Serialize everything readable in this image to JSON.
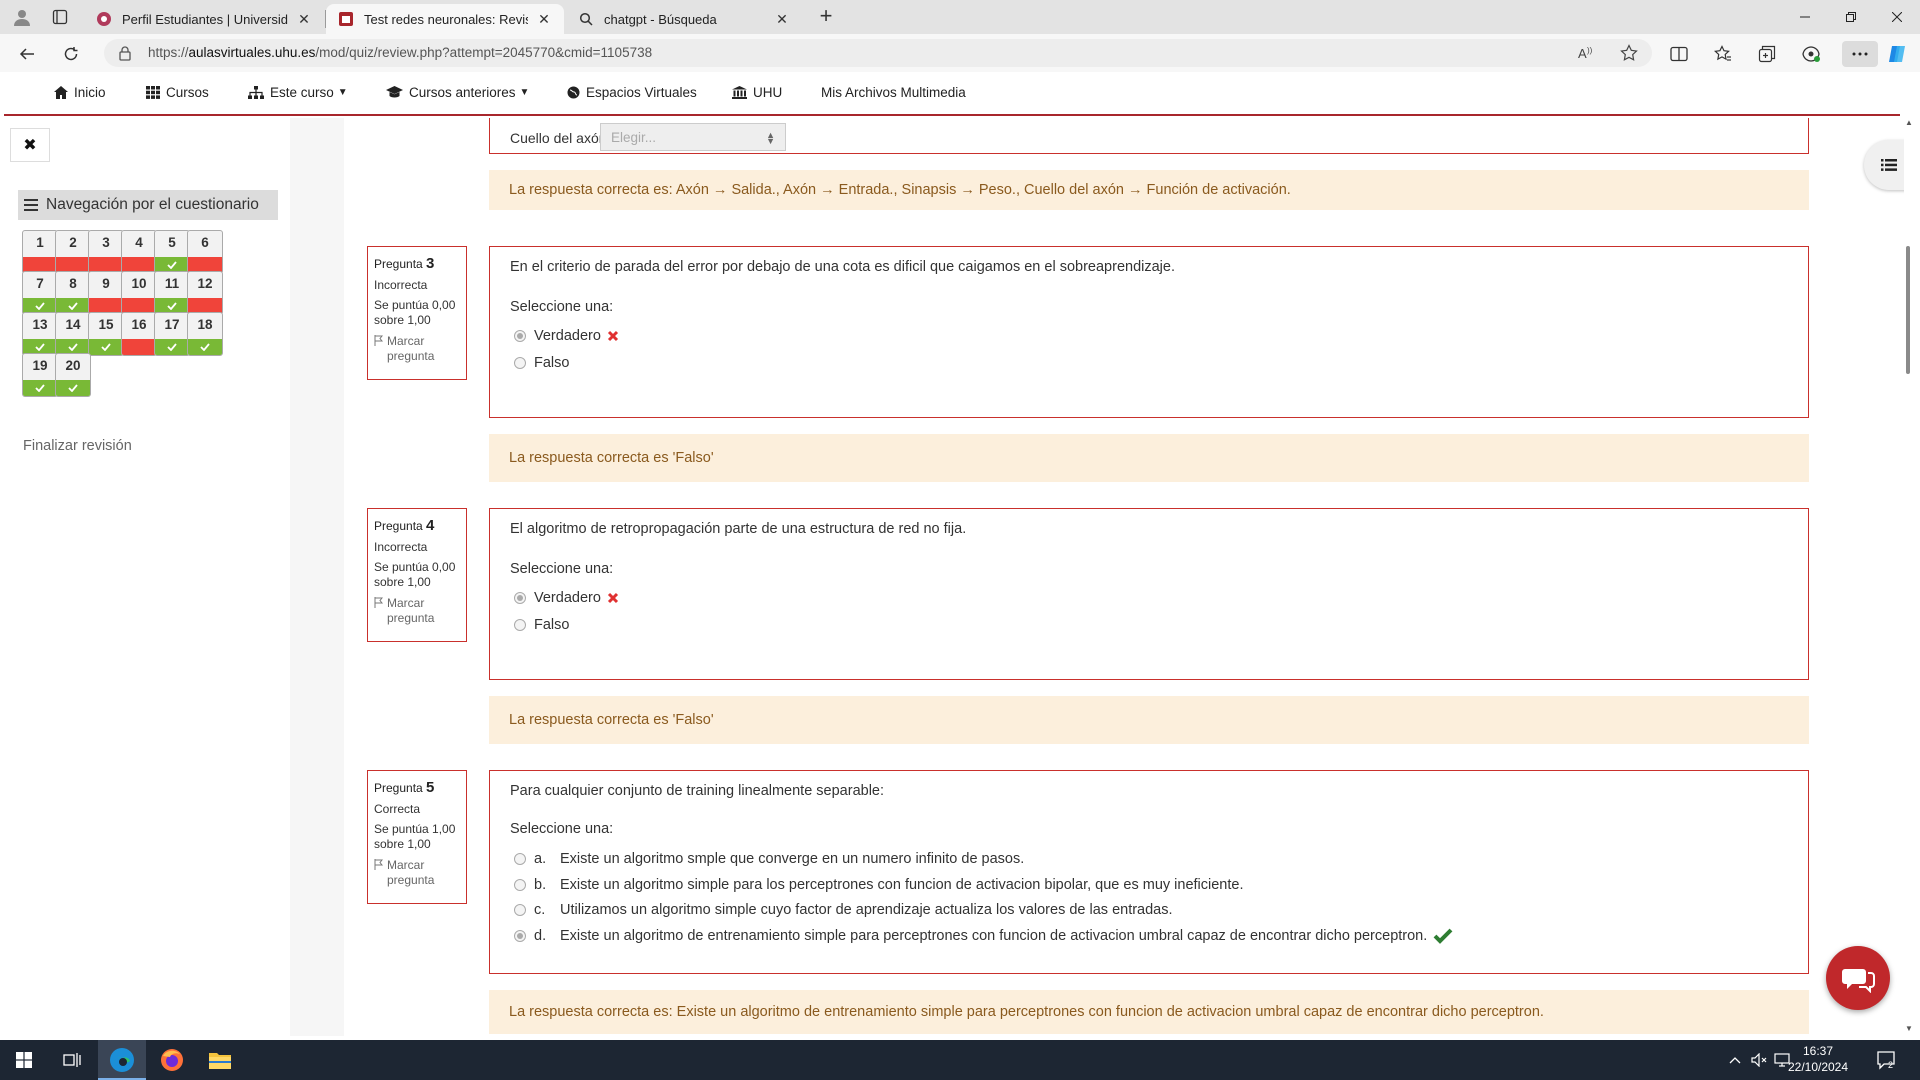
{
  "browser": {
    "tabs": [
      {
        "title": "Perfil Estudiantes | Universidad de",
        "active": false
      },
      {
        "title": "Test redes neuronales: Revisión de",
        "active": true
      },
      {
        "title": "chatgpt - Búsqueda",
        "active": false
      }
    ],
    "url_prefix": "https://",
    "url_host": "aulasvirtuales.uhu.es",
    "url_path": "/mod/quiz/review.php?attempt=2045770&cmid=1105738"
  },
  "site_nav": {
    "items": [
      {
        "label": "Inicio",
        "icon": "home-icon",
        "dropdown": false
      },
      {
        "label": "Cursos",
        "icon": "grid-icon",
        "dropdown": false
      },
      {
        "label": "Este curso",
        "icon": "sitemap-icon",
        "dropdown": true
      },
      {
        "label": "Cursos anteriores",
        "icon": "graduation-cap-icon",
        "dropdown": true
      },
      {
        "label": "Espacios Virtuales",
        "icon": "globe-icon",
        "dropdown": false
      },
      {
        "label": "UHU",
        "icon": "university-icon",
        "dropdown": false
      },
      {
        "label": "Mis Archivos Multimedia",
        "icon": "",
        "dropdown": false
      }
    ]
  },
  "quiz_nav": {
    "heading": "Navegación por el cuestionario",
    "questions": [
      {
        "n": "1",
        "status": "wrong"
      },
      {
        "n": "2",
        "status": "wrong"
      },
      {
        "n": "3",
        "status": "wrong"
      },
      {
        "n": "4",
        "status": "wrong"
      },
      {
        "n": "5",
        "status": "right"
      },
      {
        "n": "6",
        "status": "wrong"
      },
      {
        "n": "7",
        "status": "right"
      },
      {
        "n": "8",
        "status": "right"
      },
      {
        "n": "9",
        "status": "wrong"
      },
      {
        "n": "10",
        "status": "wrong"
      },
      {
        "n": "11",
        "status": "right"
      },
      {
        "n": "12",
        "status": "wrong"
      },
      {
        "n": "13",
        "status": "right"
      },
      {
        "n": "14",
        "status": "right"
      },
      {
        "n": "15",
        "status": "right"
      },
      {
        "n": "16",
        "status": "wrong"
      },
      {
        "n": "17",
        "status": "right"
      },
      {
        "n": "18",
        "status": "right"
      },
      {
        "n": "19",
        "status": "right"
      },
      {
        "n": "20",
        "status": "right"
      }
    ],
    "finish_label": "Finalizar revisión"
  },
  "q2_partial": {
    "row_label": "Cuello del axón",
    "select_value": "Elegir...",
    "feedback": "La respuesta correcta es: Axón → Salida., Axón → Entrada., Sinapsis → Peso., Cuello del axón → Función de activación."
  },
  "questions": [
    {
      "label": "Pregunta",
      "number": "3",
      "state": "Incorrecta",
      "grade": "Se puntúa 0,00 sobre 1,00",
      "flag": "Marcar pregunta",
      "text": "En el criterio de parada del error por debajo de una cota es dificil que caigamos en el sobreaprendizaje.",
      "prompt": "Seleccione una:",
      "options": [
        {
          "letter": "",
          "text": "Verdadero",
          "selected": true,
          "mark": "wrong"
        },
        {
          "letter": "",
          "text": "Falso",
          "selected": false,
          "mark": ""
        }
      ],
      "feedback": "La respuesta correcta es 'Falso'"
    },
    {
      "label": "Pregunta",
      "number": "4",
      "state": "Incorrecta",
      "grade": "Se puntúa 0,00 sobre 1,00",
      "flag": "Marcar pregunta",
      "text": "El algoritmo de retropropagación parte de una estructura de red no fija.",
      "prompt": "Seleccione una:",
      "options": [
        {
          "letter": "",
          "text": "Verdadero",
          "selected": true,
          "mark": "wrong"
        },
        {
          "letter": "",
          "text": "Falso",
          "selected": false,
          "mark": ""
        }
      ],
      "feedback": "La respuesta correcta es 'Falso'"
    },
    {
      "label": "Pregunta",
      "number": "5",
      "state": "Correcta",
      "grade": "Se puntúa 1,00 sobre 1,00",
      "flag": "Marcar pregunta",
      "text": "Para cualquier conjunto de training linealmente separable:",
      "prompt": "Seleccione una:",
      "options": [
        {
          "letter": "a.",
          "text": "Existe un algoritmo smple que converge en un numero infinito de pasos.",
          "selected": false,
          "mark": ""
        },
        {
          "letter": "b.",
          "text": "Existe un algoritmo simple para los perceptrones con funcion de activacion bipolar, que es muy ineficiente.",
          "selected": false,
          "mark": ""
        },
        {
          "letter": "c.",
          "text": "Utilizamos un algoritmo simple cuyo factor de aprendizaje actualiza los valores de las entradas.",
          "selected": false,
          "mark": ""
        },
        {
          "letter": "d.",
          "text": "Existe un algoritmo de entrenamiento simple para perceptrones con funcion de activacion umbral capaz de encontrar dicho perceptron.",
          "selected": true,
          "mark": "right"
        }
      ],
      "feedback": "La respuesta correcta es: Existe un algoritmo de entrenamiento simple para perceptrones con funcion de activacion umbral capaz de encontrar dicho perceptron."
    }
  ],
  "taskbar": {
    "time": "16:37",
    "date": "22/10/2024",
    "notifications": "2"
  },
  "colors": {
    "brand": "#a8262c",
    "wrong": "#f0443a",
    "right": "#79b936",
    "feedback_bg": "#fcefdc"
  }
}
